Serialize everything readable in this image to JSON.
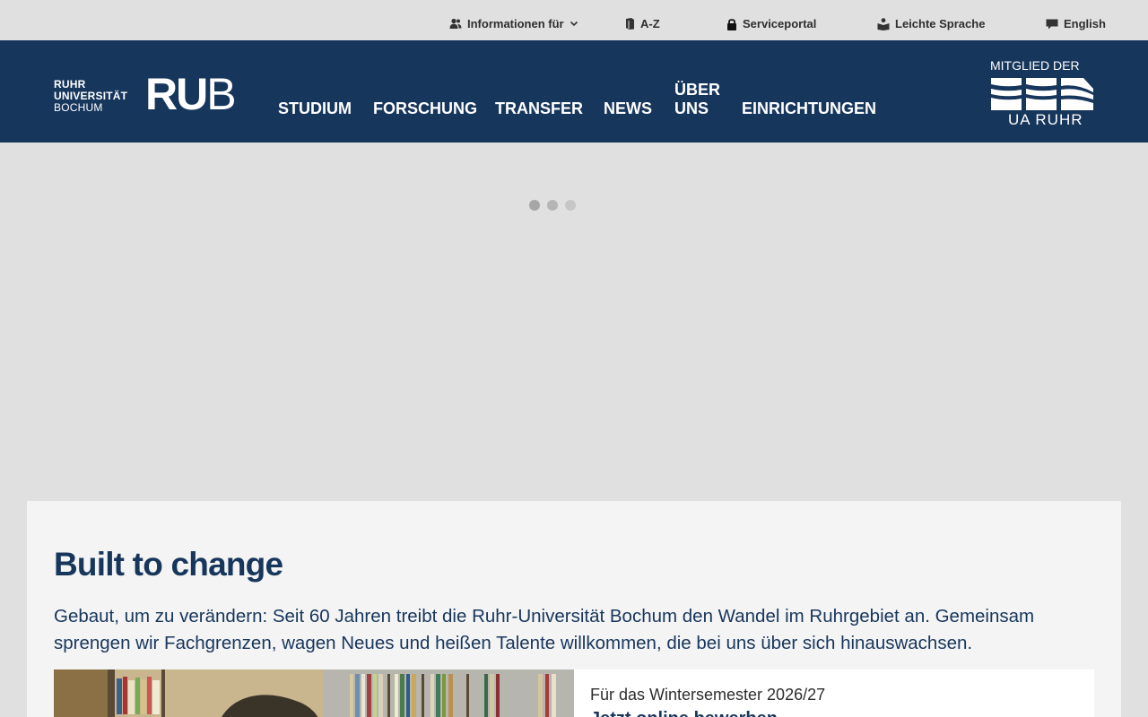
{
  "utility_nav": {
    "info_label": "Informationen für",
    "az_label": "A-Z",
    "serviceportal_label": "Serviceportal",
    "leichte_sprache_label": "Leichte Sprache",
    "english_label": "English"
  },
  "logo": {
    "line1": "RUHR",
    "line2": "UNIVERSITÄT",
    "line3": "BOCHUM",
    "mark_ru": "RU",
    "mark_b": "B"
  },
  "main_nav": {
    "items": [
      {
        "label": "STUDIUM"
      },
      {
        "label": "FORSCHUNG"
      },
      {
        "label": "TRANSFER"
      },
      {
        "label": "NEWS"
      },
      {
        "label": "ÜBER UNS"
      },
      {
        "label": "EINRICHTUNGEN"
      }
    ]
  },
  "ua_ruhr": {
    "title": "MITGLIED DER",
    "subtitle": "UA RUHR"
  },
  "content": {
    "heading": "Built to change",
    "intro": "Gebaut, um zu verändern: Seit 60 Jahren treibt die Ruhr-Universität Bochum den Wandel im Ruhrgebiet an. Gemeinsam sprengen wir Fachgrenzen, wagen Neues und heißen Talente willkommen, die bei uns über sich hinauswachsen.",
    "teaser_label": "Für das Wintersemester 2026/27",
    "teaser_title": "Jetzt online bewerben"
  },
  "colors": {
    "brand_blue": "#17365c",
    "top_bar": "#e0e0e0",
    "card_bg": "#f4f4f4"
  }
}
